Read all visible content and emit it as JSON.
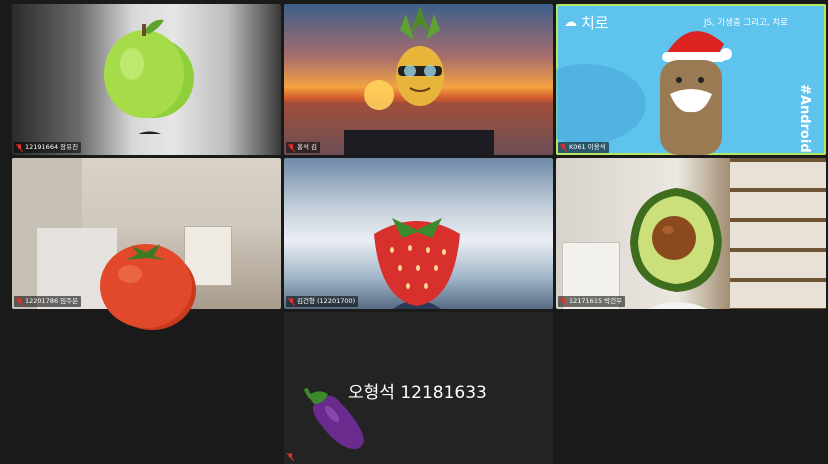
{
  "participants": [
    {
      "name": "12191664 장유진",
      "muted": true
    },
    {
      "name": "홍석 김",
      "muted": true
    },
    {
      "name": "K061 이용석",
      "muted": true,
      "active": true
    },
    {
      "name": "12201786 임주은",
      "muted": true
    },
    {
      "name": "김건형 (12201700)",
      "muted": true
    },
    {
      "name": "12171615 박건우",
      "muted": true
    },
    {
      "name": "오형석 12181633",
      "muted": true,
      "video_off": true
    }
  ],
  "backgrounds": {
    "t3_brand": "치로",
    "t3_tagline": "JS, 기생충 그리고, 치로",
    "t3_hashtag": "#Android"
  },
  "colors": {
    "active_border": "#b9e65f",
    "muted_mic": "#e0322a"
  }
}
